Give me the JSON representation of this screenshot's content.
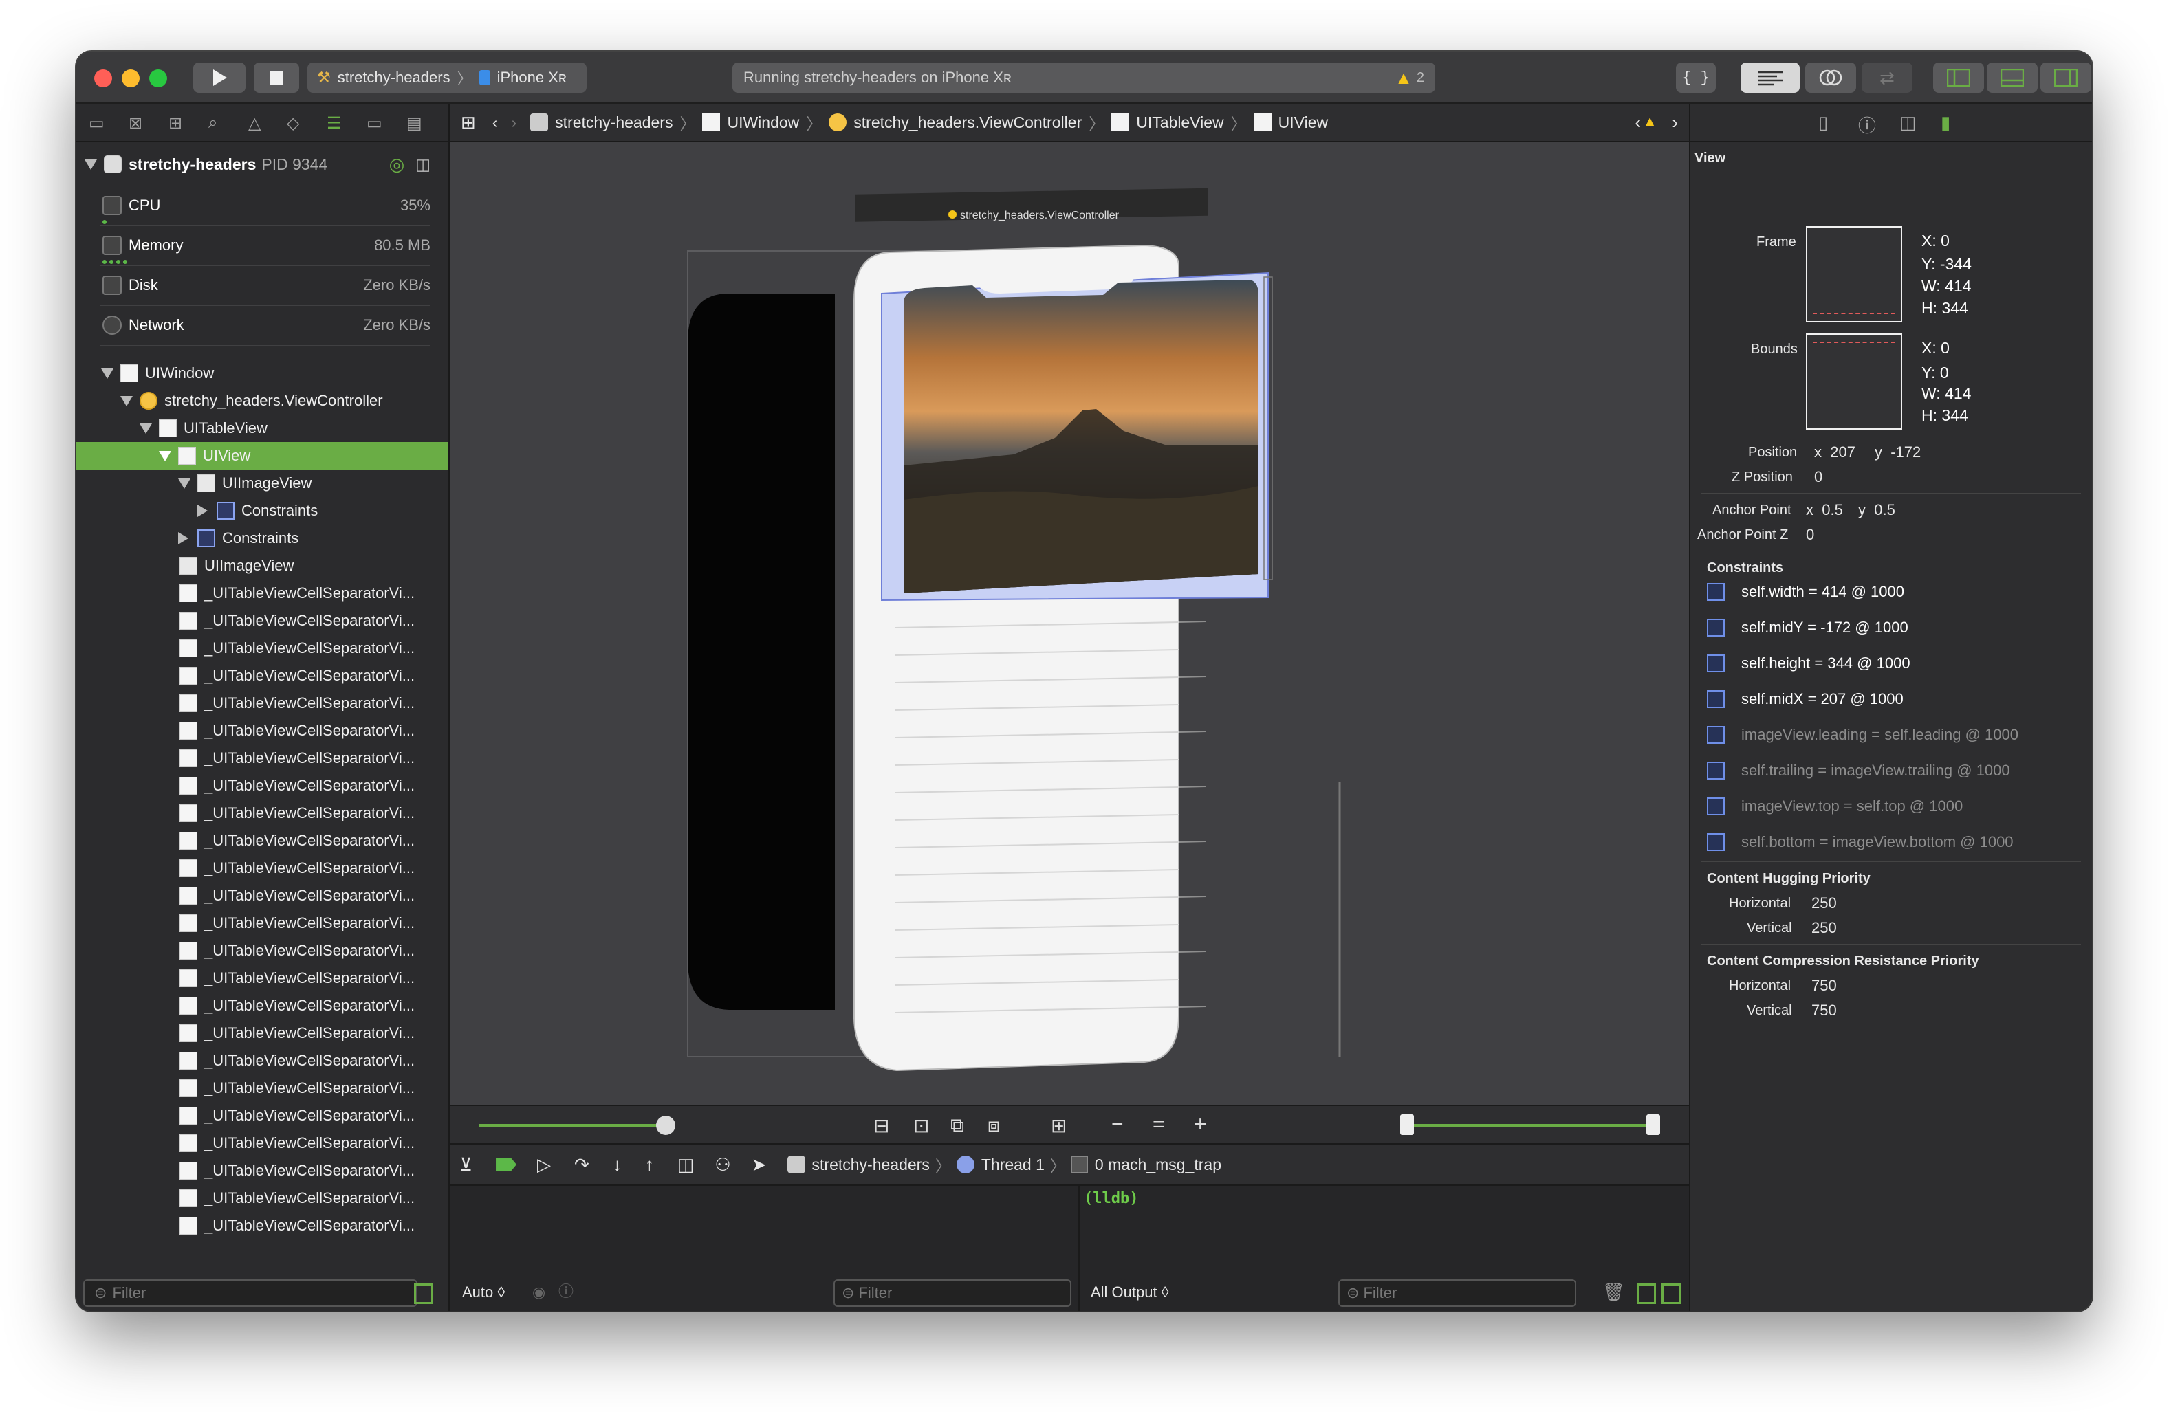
{
  "toolbar": {
    "scheme": "stretchy-headers",
    "device": "iPhone Xʀ",
    "status": "Running stretchy-headers on iPhone Xʀ",
    "warnings": "2",
    "code_review": "{ }"
  },
  "navigator": {
    "process": {
      "name": "stretchy-headers",
      "pid": "PID 9344"
    },
    "gauges": [
      {
        "name": "CPU",
        "value": "35%"
      },
      {
        "name": "Memory",
        "value": "80.5 MB"
      },
      {
        "name": "Disk",
        "value": "Zero KB/s"
      },
      {
        "name": "Network",
        "value": "Zero KB/s"
      }
    ],
    "tree": [
      {
        "label": "UIWindow"
      },
      {
        "label": "stretchy_headers.ViewController"
      },
      {
        "label": "UITableView"
      },
      {
        "label": "UIView"
      },
      {
        "label": "UIImageView"
      },
      {
        "label": "Constraints"
      },
      {
        "label": "Constraints"
      },
      {
        "label": "UIImageView"
      },
      {
        "label": "_UITableViewCellSeparatorVi..."
      },
      {
        "label": "_UITableViewCellSeparatorVi..."
      },
      {
        "label": "_UITableViewCellSeparatorVi..."
      },
      {
        "label": "_UITableViewCellSeparatorVi..."
      },
      {
        "label": "_UITableViewCellSeparatorVi..."
      },
      {
        "label": "_UITableViewCellSeparatorVi..."
      },
      {
        "label": "_UITableViewCellSeparatorVi..."
      },
      {
        "label": "_UITableViewCellSeparatorVi..."
      },
      {
        "label": "_UITableViewCellSeparatorVi..."
      },
      {
        "label": "_UITableViewCellSeparatorVi..."
      },
      {
        "label": "_UITableViewCellSeparatorVi..."
      },
      {
        "label": "_UITableViewCellSeparatorVi..."
      },
      {
        "label": "_UITableViewCellSeparatorVi..."
      },
      {
        "label": "_UITableViewCellSeparatorVi..."
      },
      {
        "label": "_UITableViewCellSeparatorVi..."
      },
      {
        "label": "_UITableViewCellSeparatorVi..."
      },
      {
        "label": "_UITableViewCellSeparatorVi..."
      },
      {
        "label": "_UITableViewCellSeparatorVi..."
      },
      {
        "label": "_UITableViewCellSeparatorVi..."
      },
      {
        "label": "_UITableViewCellSeparatorVi..."
      },
      {
        "label": "_UITableViewCellSeparatorVi..."
      },
      {
        "label": "_UITableViewCellSeparatorVi..."
      },
      {
        "label": "_UITableViewCellSeparatorVi..."
      },
      {
        "label": "_UITableViewCellSeparatorVi..."
      }
    ],
    "filter_placeholder": "Filter"
  },
  "jumpbar": {
    "items": [
      "stretchy-headers",
      "UIWindow",
      "stretchy_headers.ViewController",
      "UITableView",
      "UIView"
    ]
  },
  "canvas": {
    "vc_label": "stretchy_headers.ViewController"
  },
  "debug_bar": {
    "target": "stretchy-headers",
    "thread": "Thread 1",
    "frame": "0 mach_msg_trap"
  },
  "bottom": {
    "auto": "Auto ◊",
    "filter_placeholder": "Filter",
    "console_prompt": "(lldb)",
    "output": "All Output ◊"
  },
  "inspector": {
    "section": "View",
    "frame": {
      "label": "Frame",
      "x": "X: 0",
      "y": "Y: -344",
      "w": "W: 414",
      "h": "H: 344"
    },
    "bounds": {
      "label": "Bounds",
      "x": "X: 0",
      "y": "Y: 0",
      "w": "W: 414",
      "h": "H: 344"
    },
    "position": {
      "label": "Position",
      "x": "x  207",
      "y": "y  -172"
    },
    "zposition": {
      "label": "Z Position",
      "value": "0"
    },
    "anchor": {
      "label": "Anchor Point",
      "x": "x  0.5",
      "y": "y  0.5"
    },
    "anchorz": {
      "label": "Anchor Point Z",
      "value": "0"
    },
    "constraints_title": "Constraints",
    "constraints": [
      {
        "text": "self.width = 414 @ 1000",
        "active": true
      },
      {
        "text": "self.midY = -172 @ 1000",
        "active": true
      },
      {
        "text": "self.height = 344 @ 1000",
        "active": true
      },
      {
        "text": "self.midX = 207 @ 1000",
        "active": true
      },
      {
        "text": "imageView.leading = self.leading @ 1000",
        "active": false
      },
      {
        "text": "self.trailing = imageView.trailing @ 1000",
        "active": false
      },
      {
        "text": "imageView.top = self.top @ 1000",
        "active": false
      },
      {
        "text": "self.bottom = imageView.bottom @ 1000",
        "active": false
      }
    ],
    "hugging": {
      "title": "Content Hugging Priority",
      "h_label": "Horizontal",
      "h": "250",
      "v_label": "Vertical",
      "v": "250"
    },
    "compression": {
      "title": "Content Compression Resistance Priority",
      "h_label": "Horizontal",
      "h": "750",
      "v_label": "Vertical",
      "v": "750"
    }
  },
  "colors": {
    "accent": "#6aad45",
    "warning": "#f5c518",
    "bg": "#2a2a2c"
  }
}
